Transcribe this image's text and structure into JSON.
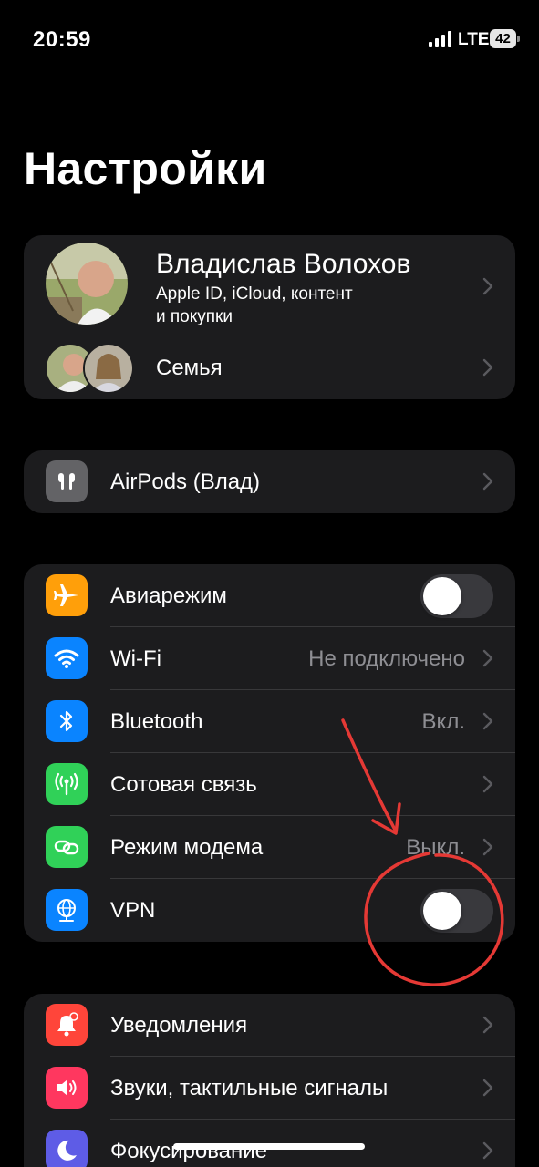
{
  "status_bar": {
    "time": "20:59",
    "network": "LTE",
    "battery": "42"
  },
  "page_title": "Настройки",
  "profile": {
    "name": "Владислав Волохов",
    "subtitle_line1": "Apple ID, iCloud, контент",
    "subtitle_line2": "и покупки",
    "family_label": "Семья"
  },
  "device": {
    "label": "AirPods (Влад)"
  },
  "connectivity": {
    "airplane": {
      "label": "Авиарежим",
      "on": false
    },
    "wifi": {
      "label": "Wi-Fi",
      "value": "Не подключено"
    },
    "bluetooth": {
      "label": "Bluetooth",
      "value": "Вкл."
    },
    "cellular": {
      "label": "Сотовая связь"
    },
    "hotspot": {
      "label": "Режим модема",
      "value": "Выкл."
    },
    "vpn": {
      "label": "VPN",
      "on": false
    }
  },
  "notifications_group": {
    "notifications": {
      "label": "Уведомления"
    },
    "sounds": {
      "label": "Звуки, тактильные сигналы"
    },
    "focus": {
      "label": "Фокусирование"
    }
  },
  "colors": {
    "airplane": "#ff9f0a",
    "wifi": "#0a84ff",
    "bluetooth": "#0a84ff",
    "cellular": "#30d158",
    "hotspot": "#30d158",
    "vpn": "#0a84ff",
    "notifications": "#ff453a",
    "sounds": "#ff375f",
    "focus": "#5e5ce6",
    "annotation": "#e53935"
  },
  "icons": {
    "airplane": "airplane-icon",
    "wifi": "wifi-icon",
    "bluetooth": "bluetooth-icon",
    "cellular": "antenna-icon",
    "hotspot": "link-icon",
    "vpn": "globe-icon",
    "notifications": "bell-icon",
    "sounds": "speaker-icon",
    "focus": "moon-icon"
  }
}
